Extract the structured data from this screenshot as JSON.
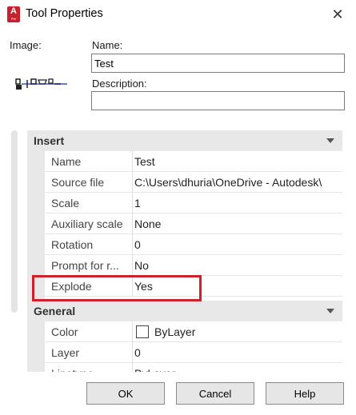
{
  "window": {
    "title": "Tool Properties",
    "app_icon": {
      "letter": "A",
      "sub": "PW"
    }
  },
  "form": {
    "image_label": "Image:",
    "name_label": "Name:",
    "name_value": "Test",
    "description_label": "Description:",
    "description_value": ""
  },
  "sections": [
    {
      "title": "Insert",
      "rows": [
        {
          "name": "Name",
          "value": "Test"
        },
        {
          "name": "Source file",
          "value": "C:\\Users\\dhuria\\OneDrive - Autodesk\\"
        },
        {
          "name": "Scale",
          "value": "1"
        },
        {
          "name": "Auxiliary scale",
          "value": "None"
        },
        {
          "name": "Rotation",
          "value": "0"
        },
        {
          "name": "Prompt for r...",
          "value": "No"
        },
        {
          "name": "Explode",
          "value": "Yes"
        }
      ]
    },
    {
      "title": "General",
      "rows": [
        {
          "name": "Color",
          "value": "ByLayer"
        },
        {
          "name": "Layer",
          "value": "0"
        },
        {
          "name": "Linetype",
          "value": "ByLayer"
        }
      ]
    }
  ],
  "buttons": {
    "ok": "OK",
    "cancel": "Cancel",
    "help": "Help"
  },
  "colors": {
    "highlight": "#d0202c",
    "app_icon": "#c8202c",
    "section_bg": "#e8e8e8"
  }
}
